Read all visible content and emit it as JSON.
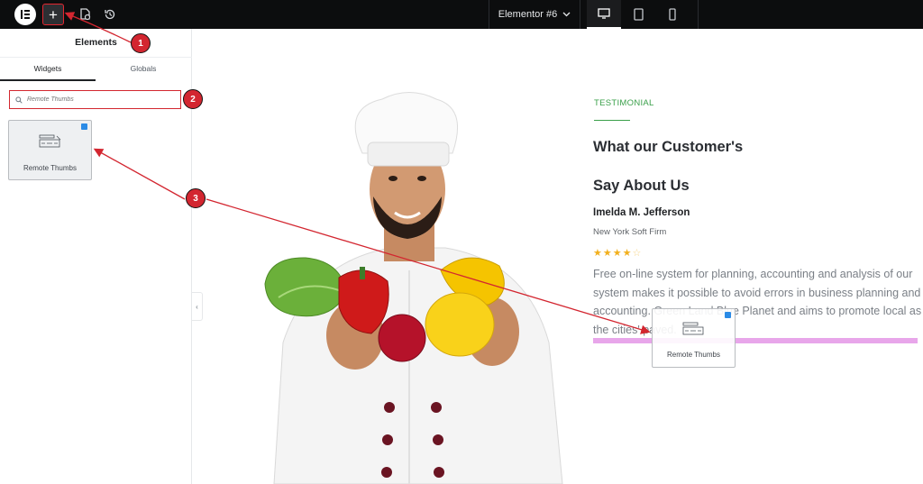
{
  "topbar": {
    "document_title": "Elementor #6",
    "icons": [
      "elementor-logo-icon",
      "add-element-icon",
      "page-settings-icon",
      "history-icon",
      "chevron-down-icon",
      "desktop-icon",
      "tablet-icon",
      "mobile-icon"
    ]
  },
  "panel": {
    "title": "Elements",
    "tabs": [
      {
        "label": "Widgets",
        "active": true
      },
      {
        "label": "Globals",
        "active": false
      }
    ],
    "search": {
      "placeholder": "Remote Thumbs",
      "value": ""
    },
    "widgets": [
      {
        "label": "Remote Thumbs",
        "icon": "remote-thumbs-icon",
        "pro": true
      }
    ]
  },
  "callouts": [
    "1",
    "2",
    "3"
  ],
  "testimonial": {
    "tag": "TESTIMONIAL",
    "heading_line1": "What our Customer's",
    "heading_line2": "Say About Us",
    "name": "Imelda M. Jefferson",
    "company": "New York Soft Firm",
    "rating": 4,
    "max_rating": 5,
    "quote": "Free on-line system for planning, accounting and analysis of our system makes it possible to avoid errors in business planning and accounting. Green Land Blue Planet and aims to promote local as the cities' paved."
  },
  "drag_ghost": {
    "label": "Remote Thumbs"
  },
  "colors": {
    "topbar_bg": "#0c0d0e",
    "callout_red": "#d32630",
    "accent_green": "#3aa04a",
    "drop_indicator": "#e8a6ea",
    "star": "#f2b01e"
  }
}
